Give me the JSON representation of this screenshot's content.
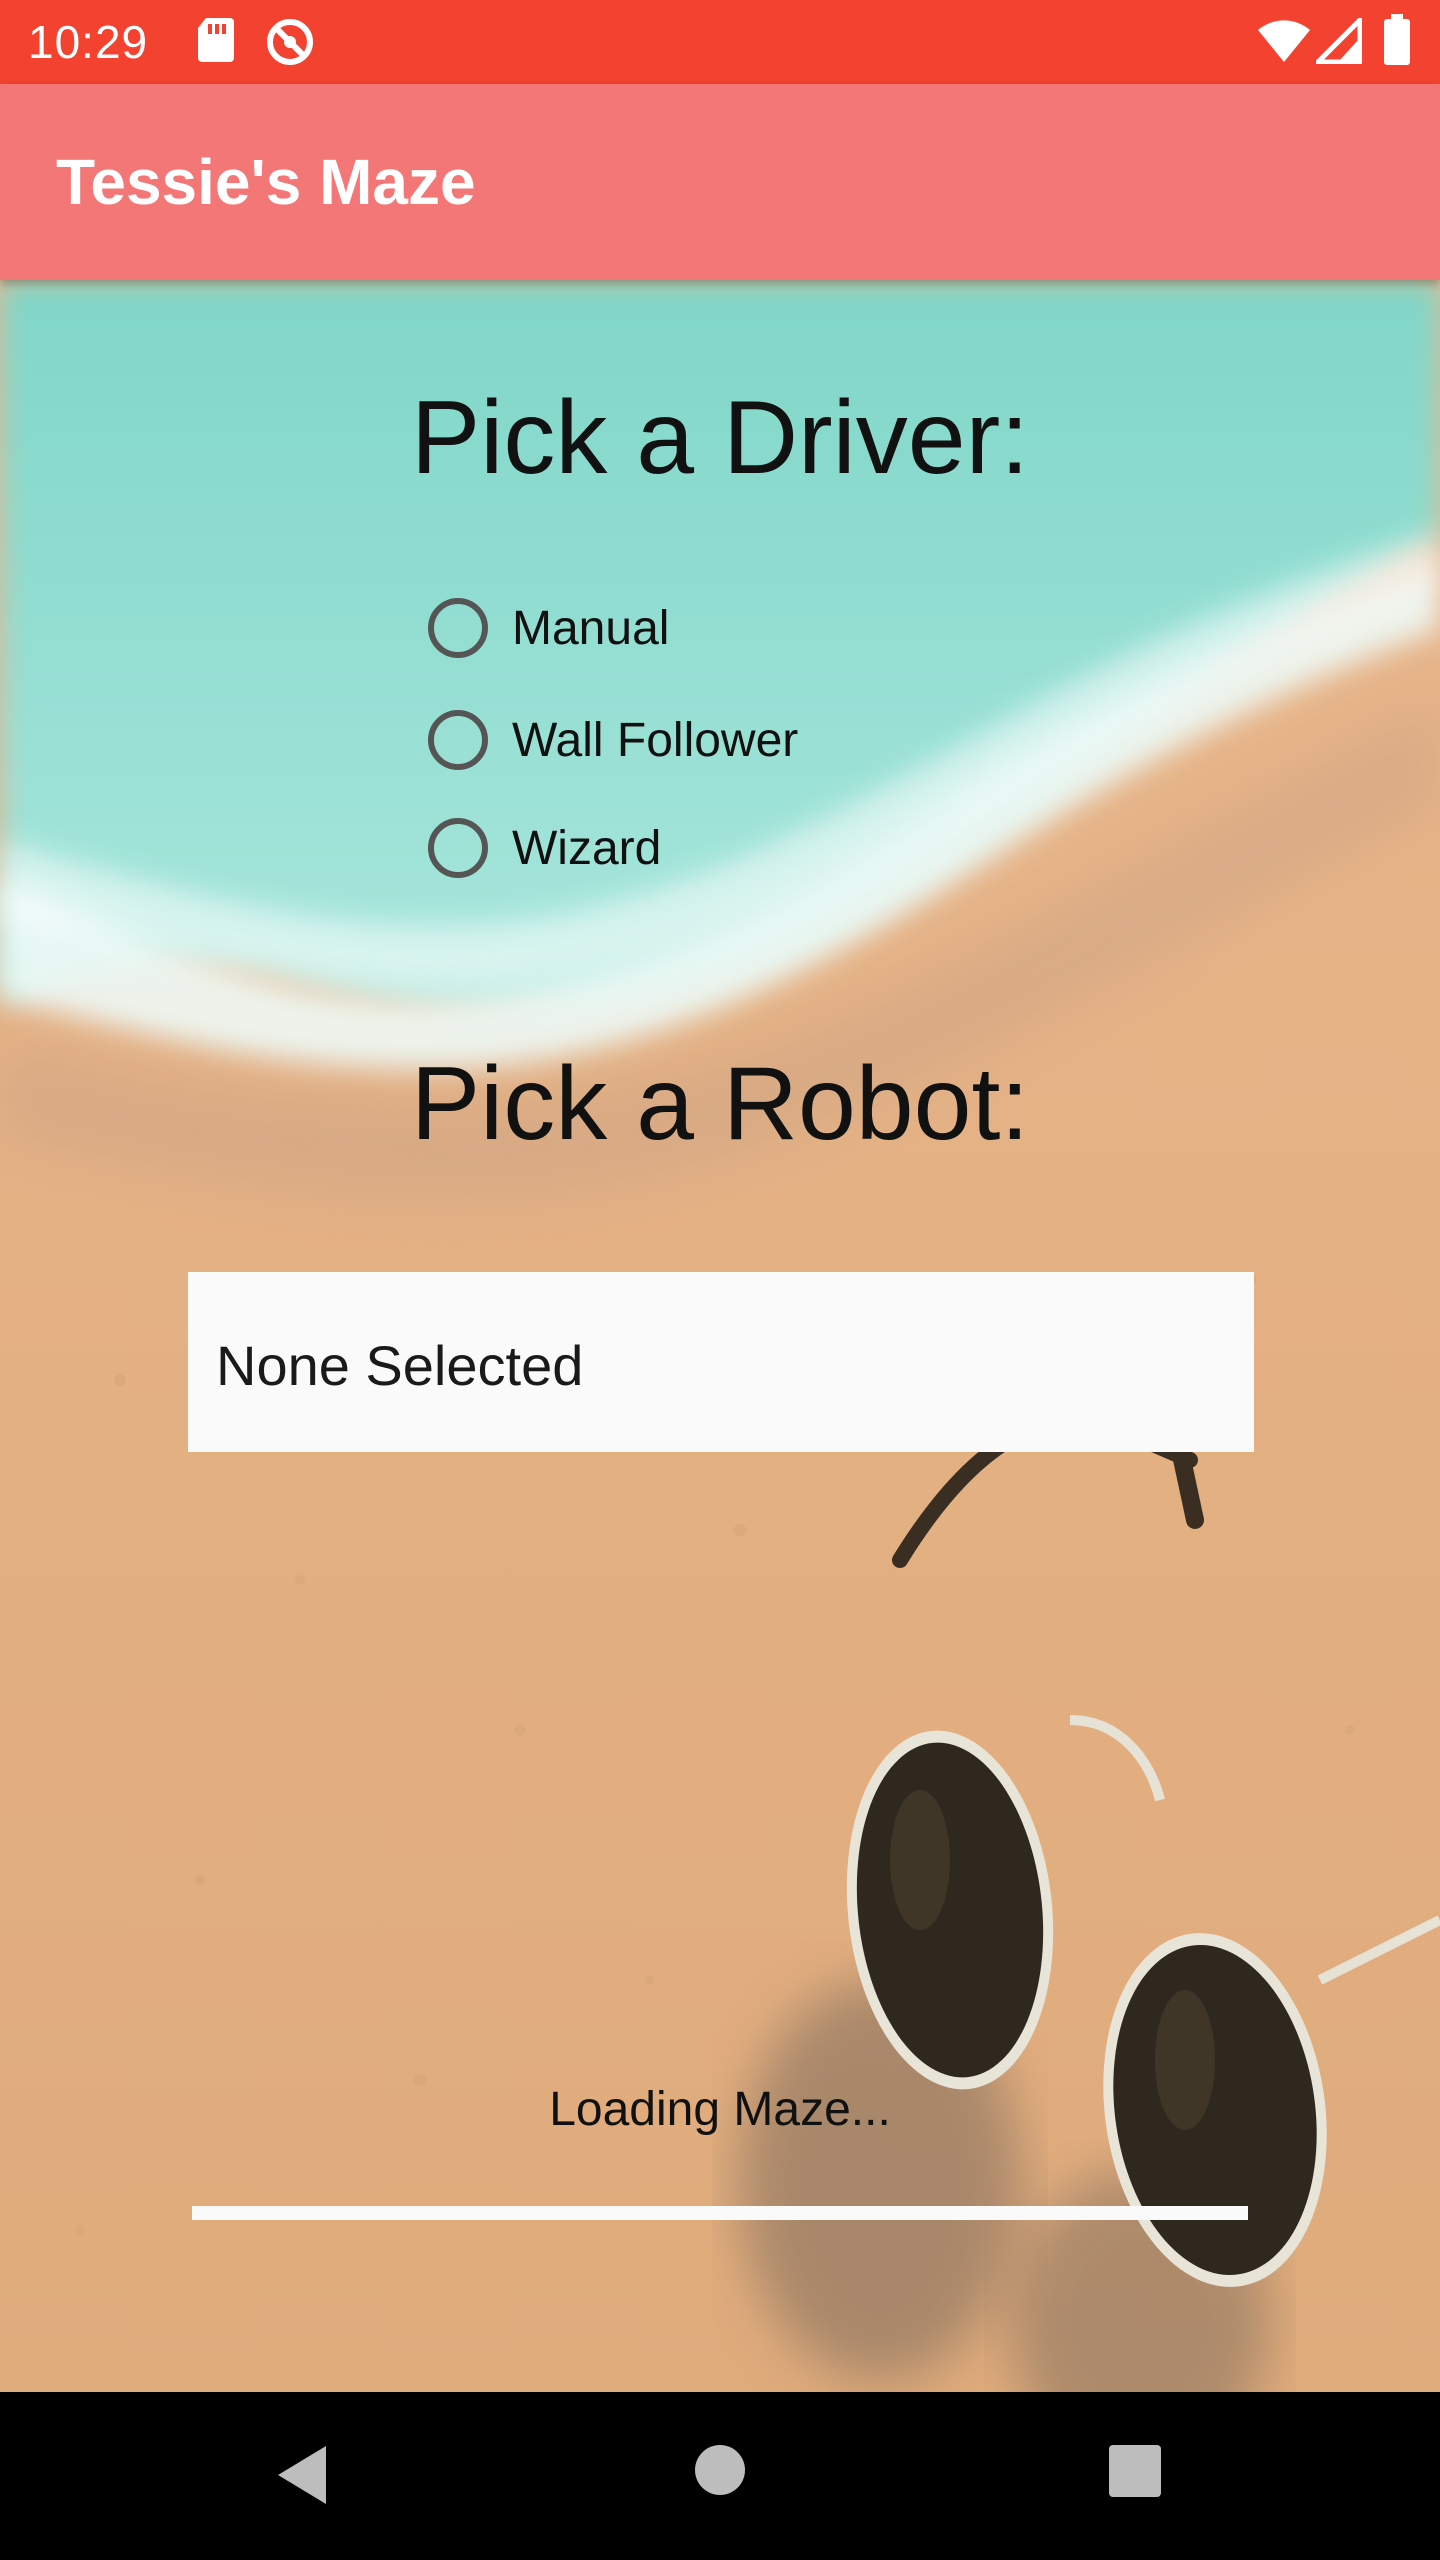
{
  "status_bar": {
    "time": "10:29",
    "icons": [
      "sd-card-icon",
      "sync-disabled-icon",
      "wifi-icon",
      "cell-signal-icon",
      "battery-icon"
    ]
  },
  "app_bar": {
    "title": "Tessie's Maze",
    "color": "#f47777"
  },
  "driver_section": {
    "heading": "Pick a Driver:",
    "options": [
      {
        "label": "Manual",
        "selected": false
      },
      {
        "label": "Wall Follower",
        "selected": false
      },
      {
        "label": "Wizard",
        "selected": false
      }
    ]
  },
  "robot_section": {
    "heading": "Pick a Robot:",
    "selected_value": "None Selected"
  },
  "loading": {
    "label": "Loading Maze...",
    "progress": 0
  },
  "nav_bar": {
    "buttons": [
      "back-icon",
      "home-icon",
      "recents-icon"
    ]
  },
  "colors": {
    "status_bar": "#f44230",
    "accent": "#f47777"
  }
}
